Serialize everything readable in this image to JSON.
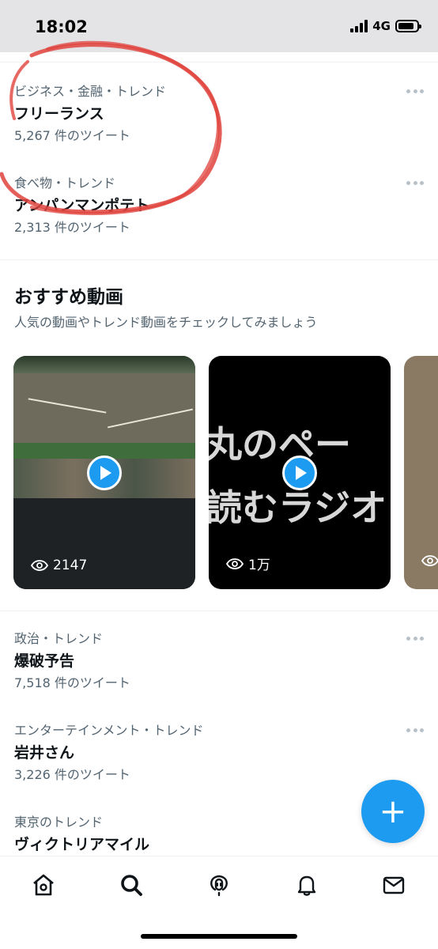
{
  "status_bar": {
    "time": "18:02",
    "network": "4G",
    "battery_level": 0.85
  },
  "trends_top": [
    {
      "category": "ビジネス・金融・トレンド",
      "name": "フリーランス",
      "count": "5,267 件のツイート"
    },
    {
      "category": "食べ物・トレンド",
      "name": "アンパンマンポテト",
      "count": "2,313 件のツイート"
    }
  ],
  "videos_section": {
    "title": "おすすめ動画",
    "subtitle": "人気の動画やトレンド動画をチェックしてみましょう",
    "videos": [
      {
        "views": "2147"
      },
      {
        "views": "1万",
        "overlay_line1": "丸のペー",
        "overlay_line2": "読むラジオ"
      },
      {
        "views": ""
      }
    ]
  },
  "trends_bottom": [
    {
      "category": "政治・トレンド",
      "name": "爆破予告",
      "count": "7,518 件のツイート"
    },
    {
      "category": "エンターテインメント・トレンド",
      "name": "岩井さん",
      "count": "3,226 件のツイート"
    },
    {
      "category": "東京のトレンド",
      "name": "ヴィクトリアマイル",
      "count": ""
    }
  ],
  "fab": {
    "label": "+"
  },
  "bottom_nav": [
    "home-icon",
    "search-icon",
    "spaces-icon",
    "notifications-icon",
    "messages-icon"
  ],
  "colors": {
    "accent": "#1d9bf0",
    "secondary_text": "#536471",
    "annotation": "#e0433d"
  }
}
